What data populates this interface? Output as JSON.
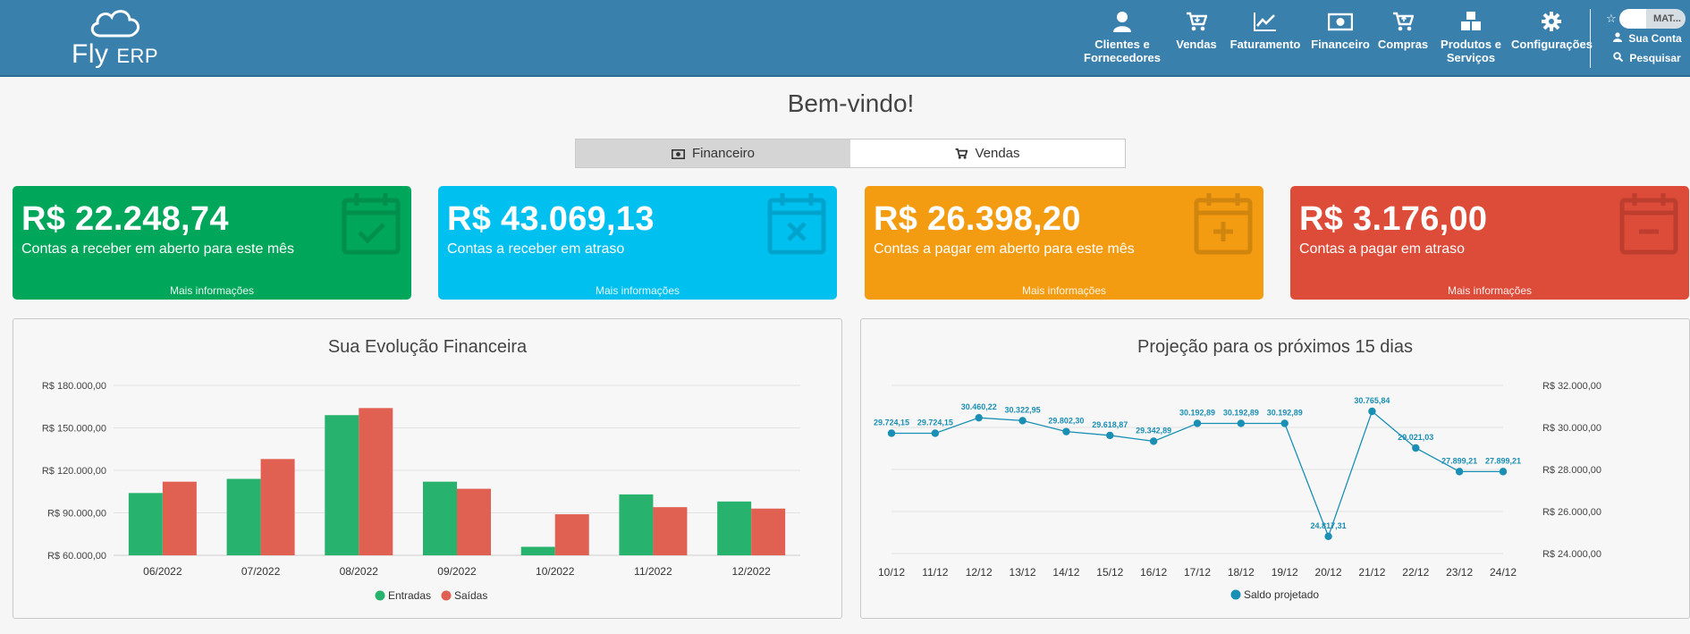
{
  "header": {
    "logo_main": "Fly",
    "logo_sub": "ERP",
    "nav": [
      {
        "label": "Clientes e\nFornecedores",
        "icon": "user-icon"
      },
      {
        "label": "Vendas",
        "icon": "cart-icon"
      },
      {
        "label": "Faturamento",
        "icon": "line-chart-icon"
      },
      {
        "label": "Financeiro",
        "icon": "money-icon"
      },
      {
        "label": "Compras",
        "icon": "cart-down-icon"
      },
      {
        "label": "Produtos e\nServiços",
        "icon": "cubes-icon"
      },
      {
        "label": "Configurações",
        "icon": "gear-icon"
      }
    ],
    "account": {
      "user_tag": "MAT...",
      "my_account": "Sua Conta",
      "search": "Pesquisar"
    }
  },
  "welcome": "Bem-vindo!",
  "tabs": [
    {
      "label": "Financeiro",
      "active": true,
      "icon": "money-icon"
    },
    {
      "label": "Vendas",
      "active": false,
      "icon": "cart-icon"
    }
  ],
  "cards": [
    {
      "value": "R$ 22.248,74",
      "label": "Contas a receber em aberto para este mês",
      "more": "Mais informações",
      "color": "#00a65a",
      "icon": "calendar-check-icon"
    },
    {
      "value": "R$ 43.069,13",
      "label": "Contas a receber em atraso",
      "more": "Mais informações",
      "color": "#00c0ef",
      "icon": "calendar-times-icon"
    },
    {
      "value": "R$ 26.398,20",
      "label": "Contas a pagar em aberto para este mês",
      "more": "Mais informações",
      "color": "#f39c12",
      "icon": "calendar-plus-icon"
    },
    {
      "value": "R$ 3.176,00",
      "label": "Contas a pagar em atraso",
      "more": "Mais informações",
      "color": "#dd4b39",
      "icon": "calendar-minus-icon"
    }
  ],
  "chart_data": [
    {
      "type": "bar",
      "title": "Sua Evolução Financeira",
      "categories": [
        "06/2022",
        "07/2022",
        "08/2022",
        "09/2022",
        "10/2022",
        "11/2022",
        "12/2022"
      ],
      "ylim": [
        60000,
        180000
      ],
      "yticks": [
        "R$ 180.000,00",
        "R$ 150.000,00",
        "R$ 120.000,00",
        "R$ 90.000,00",
        "R$ 60.000,00"
      ],
      "series": [
        {
          "name": "Entradas",
          "color": "#27b36e",
          "values": [
            104000,
            114000,
            159000,
            112000,
            66000,
            103000,
            98000
          ]
        },
        {
          "name": "Saídas",
          "color": "#e06052",
          "values": [
            112000,
            128000,
            164000,
            107000,
            89000,
            94000,
            93000
          ]
        }
      ],
      "grid": true,
      "legend": "bottom"
    },
    {
      "type": "line",
      "title": "Projeção para os próximos 15 dias",
      "x": [
        "10/12",
        "11/12",
        "12/12",
        "13/12",
        "14/12",
        "15/12",
        "16/12",
        "17/12",
        "18/12",
        "19/12",
        "20/12",
        "21/12",
        "22/12",
        "23/12",
        "24/12"
      ],
      "ylim": [
        24000,
        32000
      ],
      "yticks": [
        "R$ 32.000,00",
        "R$ 30.000,00",
        "R$ 28.000,00",
        "R$ 26.000,00",
        "R$ 24.000,00"
      ],
      "series": [
        {
          "name": "Saldo projetado",
          "color": "#1a8fb5",
          "values": [
            29724.15,
            29724.15,
            30460.22,
            30322.95,
            29802.3,
            29618.87,
            29342.89,
            30192.89,
            30192.89,
            30192.89,
            24817.31,
            30765.84,
            29021.03,
            27899.21,
            27899.21
          ],
          "labels": [
            "29.724,15",
            "29.724,15",
            "30.460,22",
            "30.322,95",
            "29.802,30",
            "29.618,87",
            "29.342,89",
            "30.192,89",
            "30.192,89",
            "30.192,89",
            "24.817,31",
            "30.765,84",
            "29.021,03",
            "27.899,21",
            "27.899,21"
          ]
        }
      ],
      "grid": true,
      "legend": "bottom"
    }
  ]
}
